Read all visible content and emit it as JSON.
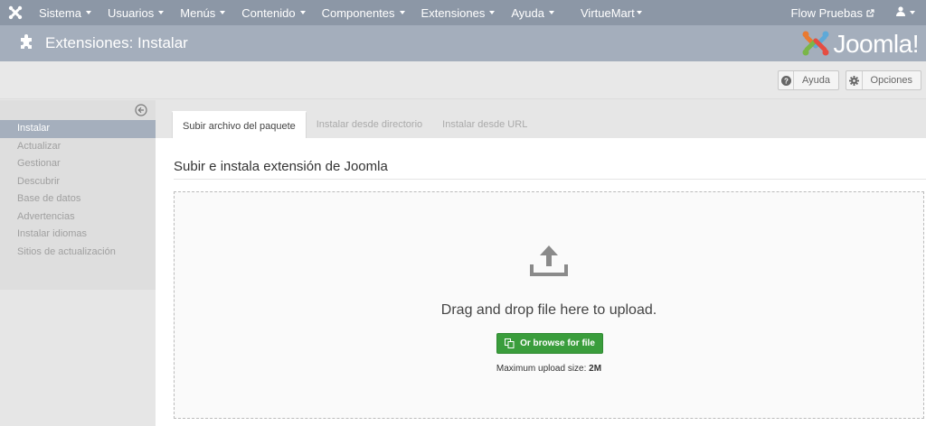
{
  "nav": {
    "items": [
      {
        "label": "Sistema",
        "caret": true
      },
      {
        "label": "Usuarios",
        "caret": true
      },
      {
        "label": "Menús",
        "caret": true
      },
      {
        "label": "Contenido",
        "caret": true
      },
      {
        "label": "Componentes",
        "caret": true
      },
      {
        "label": "Extensiones",
        "caret": true
      },
      {
        "label": "Ayuda",
        "caret": true
      },
      {
        "label": "VirtueMart",
        "caret": true
      }
    ],
    "site_label": "Flow Pruebas",
    "logo_icon": "joomla-logo-icon",
    "user_icon": "user-icon"
  },
  "header": {
    "title": "Extensiones: Instalar",
    "icon": "puzzle-icon",
    "brand": "Joomla!"
  },
  "toolbar": {
    "help_label": "Ayuda",
    "options_label": "Opciones"
  },
  "sidebar": {
    "items": [
      {
        "label": "Instalar",
        "active": true
      },
      {
        "label": "Actualizar",
        "active": false
      },
      {
        "label": "Gestionar",
        "active": false
      },
      {
        "label": "Descubrir",
        "active": false
      },
      {
        "label": "Base de datos",
        "active": false
      },
      {
        "label": "Advertencias",
        "active": false
      },
      {
        "label": "Instalar idiomas",
        "active": false
      },
      {
        "label": "Sitios de actualización",
        "active": false
      }
    ]
  },
  "tabs": [
    {
      "label": "Subir archivo del paquete",
      "active": true
    },
    {
      "label": "Instalar desde directorio",
      "active": false
    },
    {
      "label": "Instalar desde URL",
      "active": false
    }
  ],
  "upload": {
    "section_title": "Subir e instala extensión de Joomla",
    "drag_text": "Drag and drop file here to upload.",
    "browse_label": "Or browse for file",
    "max_size_label": "Maximum upload size:",
    "max_size_value": "2M"
  },
  "colors": {
    "navbar": "#8c97a6",
    "header": "#a4aebc",
    "active_sidebar": "#a5afbd",
    "browse_button": "#3a9d3c"
  }
}
